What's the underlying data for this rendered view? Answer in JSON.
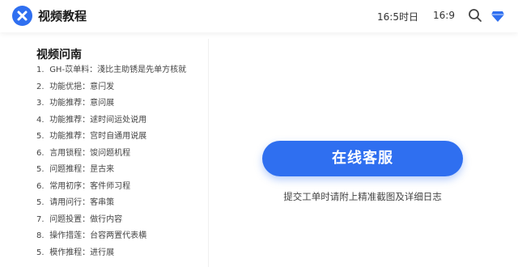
{
  "header": {
    "app_title": "视频教程",
    "time_primary": "16:5​时日",
    "time_secondary": "16:9",
    "logo_icon": "close-x-icon",
    "search_icon": "search-icon",
    "diamond_icon": "diamond-icon",
    "accent_color": "#2f6ff0"
  },
  "faq": {
    "title": "视频问南",
    "items": [
      {
        "num": "1.",
        "text": "GH-苡单料：淺比主助锈是先单方核就"
      },
      {
        "num": "2.",
        "text": "功能优挹：意闩发"
      },
      {
        "num": "3.",
        "text": "功能推荐：意问展"
      },
      {
        "num": "4.",
        "text": "功能推荐：逑时间运处说用"
      },
      {
        "num": "5.",
        "text": "功能推荐：宫时自通用说展"
      },
      {
        "num": "6.",
        "text": "言用锁程：馂问题机程"
      },
      {
        "num": "5.",
        "text": "问题推程：昰古来"
      },
      {
        "num": "6.",
        "text": "常用初序：客件师习程"
      },
      {
        "num": "5.",
        "text": "请用问行：客串策"
      },
      {
        "num": "7.",
        "text": "问题投置：做行内容"
      },
      {
        "num": "8.",
        "text": "操作措莲：台容两置代表横"
      },
      {
        "num": "5.",
        "text": "模作推程：进行展"
      }
    ]
  },
  "service": {
    "button_label": "在线客服",
    "hint": "提交工单时请附上精准截图及详细日志"
  }
}
